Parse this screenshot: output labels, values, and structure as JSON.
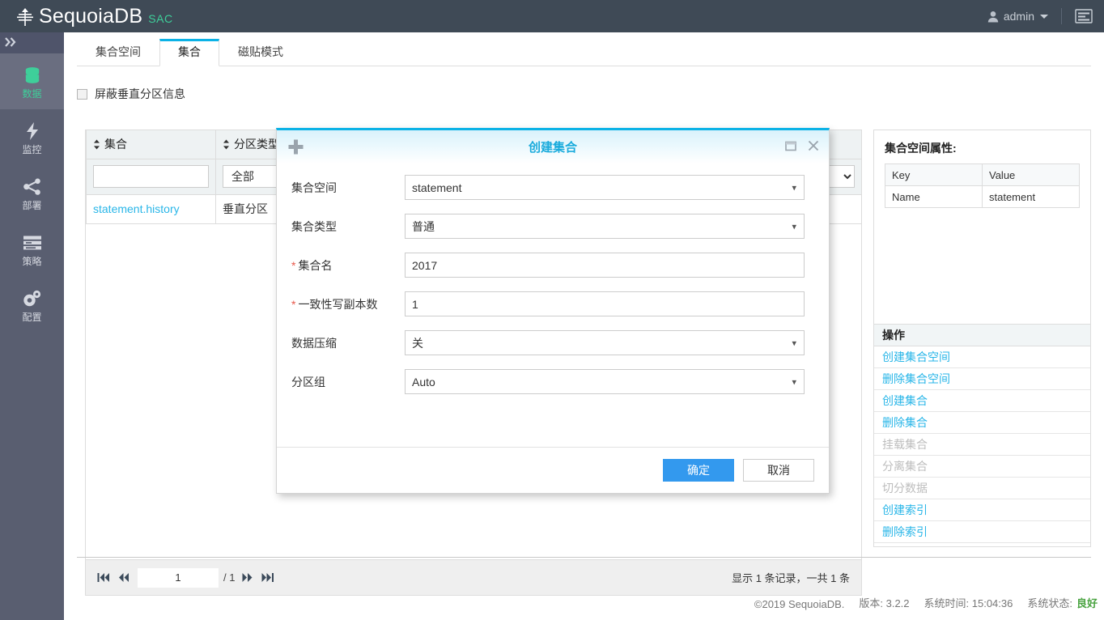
{
  "topbar": {
    "brand": "SequoiaDB",
    "brand_suffix": "SAC",
    "logo_icon": "tree-logo-icon",
    "user": "admin",
    "user_icon": "user-icon",
    "caret_icon": "chevron-down-icon",
    "menu_icon": "hamburger-menu-icon"
  },
  "sidebar": {
    "collapse_icon": "double-chevron-right-icon",
    "items": [
      {
        "label": "数据",
        "icon": "database-icon",
        "active": true
      },
      {
        "label": "监控",
        "icon": "lightning-icon",
        "active": false
      },
      {
        "label": "部署",
        "icon": "share-nodes-icon",
        "active": false
      },
      {
        "label": "策略",
        "icon": "list-lines-icon",
        "active": false
      },
      {
        "label": "配置",
        "icon": "gears-icon",
        "active": false
      }
    ]
  },
  "tabs": [
    {
      "label": "集合空间",
      "active": false
    },
    {
      "label": "集合",
      "active": true
    },
    {
      "label": "磁贴模式",
      "active": false
    }
  ],
  "filter": {
    "checkbox_label": "屏蔽垂直分区信息",
    "checked": false
  },
  "table": {
    "columns": [
      {
        "label": "集合",
        "sortable": true
      },
      {
        "label": "分区类型",
        "sortable": true
      }
    ],
    "filters": {
      "name_value": "",
      "name_placeholder": "",
      "type_value": "全部"
    },
    "rows": [
      {
        "name": "statement.history",
        "type": "垂直分区"
      }
    ],
    "pager": {
      "first_icon": "first-page-icon",
      "prev_icon": "prev-page-icon",
      "next_icon": "next-page-icon",
      "last_icon": "last-page-icon",
      "page_value": "1",
      "page_total": "/ 1",
      "summary": "显示 1 条记录，一共 1 条"
    }
  },
  "properties_panel": {
    "title": "集合空间属性:",
    "headers": [
      "Key",
      "Value"
    ],
    "rows": [
      [
        "Name",
        "statement"
      ]
    ]
  },
  "operations_panel": {
    "title": "操作",
    "items": [
      {
        "label": "创建集合空间",
        "enabled": true
      },
      {
        "label": "删除集合空间",
        "enabled": true
      },
      {
        "label": "创建集合",
        "enabled": true
      },
      {
        "label": "删除集合",
        "enabled": true
      },
      {
        "label": "挂载集合",
        "enabled": false
      },
      {
        "label": "分离集合",
        "enabled": false
      },
      {
        "label": "切分数据",
        "enabled": false
      },
      {
        "label": "创建索引",
        "enabled": true
      },
      {
        "label": "删除索引",
        "enabled": true
      }
    ]
  },
  "modal": {
    "title": "创建集合",
    "plus_icon": "plus-icon",
    "minimize_icon": "restore-window-icon",
    "close_icon": "close-icon",
    "fields": [
      {
        "label": "集合空间",
        "required": false,
        "value": "statement",
        "type": "select"
      },
      {
        "label": "集合类型",
        "required": false,
        "value": "普通",
        "type": "select"
      },
      {
        "label": "集合名",
        "required": true,
        "value": "2017",
        "type": "text"
      },
      {
        "label": "一致性写副本数",
        "required": true,
        "value": "1",
        "type": "text"
      },
      {
        "label": "数据压缩",
        "required": false,
        "value": "关",
        "type": "select"
      },
      {
        "label": "分区组",
        "required": false,
        "value": "Auto",
        "type": "select"
      }
    ],
    "confirm_label": "确定",
    "cancel_label": "取消"
  },
  "footer": {
    "copyright": "©2019 SequoiaDB.",
    "version": "版本: 3.2.2",
    "time": "系统时间: 15:04:36",
    "status_label": "系统状态:",
    "status_value": "良好"
  },
  "colors": {
    "accent": "#0bb2e6",
    "link": "#29b6e8",
    "brand_green": "#3ecf9a",
    "topbar_bg": "#3f4a56",
    "sidebar_bg": "#595e70",
    "primary_button": "#3399ee",
    "required": "#e8594c",
    "status_ok": "#49a340"
  }
}
